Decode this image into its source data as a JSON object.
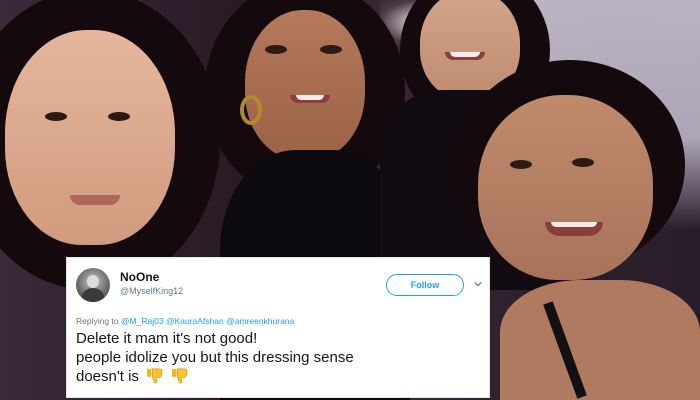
{
  "tweet": {
    "display_name": "NoOne",
    "handle": "@MyselfKing12",
    "follow_label": "Follow",
    "replying_prefix": "Replying to",
    "mentions": [
      "@M_Raj03",
      "@KauraAfshan",
      "@amreenkhurana"
    ],
    "text_lines": [
      "Delete it mam it's not good!",
      "people idolize you but this dressing sense",
      "doesn't is"
    ],
    "emoji": [
      "thumbs-down-icon",
      "thumbs-down-icon"
    ],
    "colors": {
      "link": "#1da1f2",
      "muted": "#657786",
      "text": "#14171a"
    }
  },
  "photo": {
    "description_icon": "group-selfie-photo"
  }
}
